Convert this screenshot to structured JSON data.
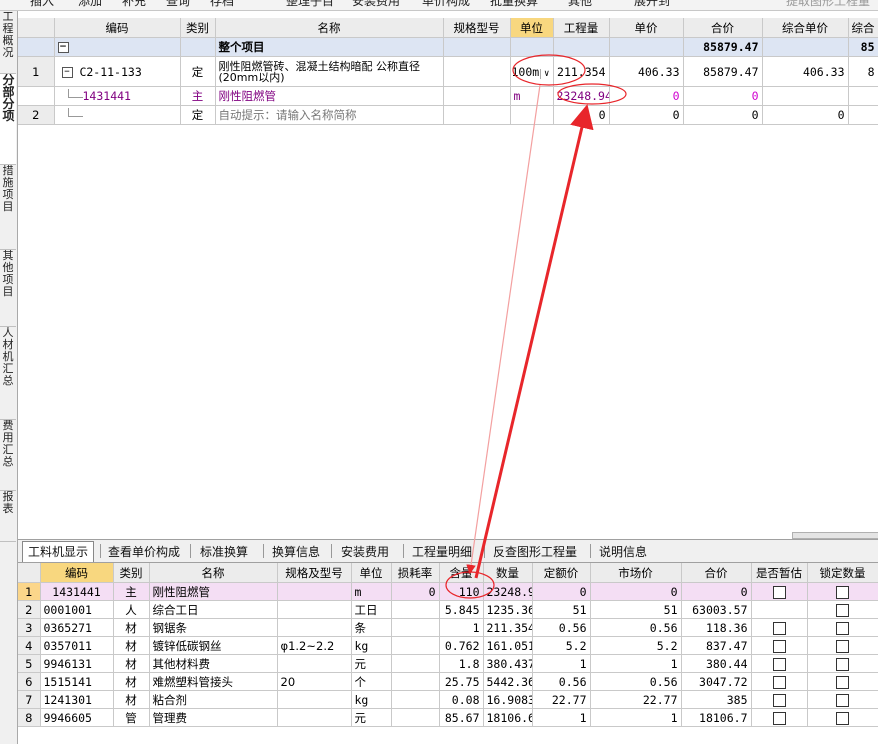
{
  "toolbar": [
    "插入",
    "添加",
    "补充",
    "查询",
    "存档",
    "整理子目",
    "安装费用",
    "单价构成",
    "批量换算",
    "其他",
    "展开到",
    "提取图形工程量"
  ],
  "side_tabs": [
    "工程概况",
    "分部分项",
    "措施项目",
    "其他项目",
    "人材机汇总",
    "费用汇总",
    "报表"
  ],
  "top_grid": {
    "headers": [
      "",
      "编码",
      "类别",
      "名称",
      "规格型号",
      "单位",
      "工程量",
      "单价",
      "合价",
      "综合单价",
      "综合"
    ],
    "total_row": {
      "toggle": "−",
      "name": "整个项目",
      "hejia": "85879.47",
      "zonghe_partial": "85"
    },
    "rows": [
      {
        "no": "1",
        "toggle": "−",
        "code": "C2-11-133",
        "type": "定",
        "name": "刚性阻燃管砖、混凝土结构暗配 公称直径(20mm以内)",
        "unit": "100m",
        "qty": "211.354",
        "price": "406.33",
        "total": "85879.47",
        "zh_price": "406.33",
        "zh_partial": "8"
      },
      {
        "no": "",
        "code": "1431441",
        "type": "主",
        "name": "刚性阻燃管",
        "unit": "m",
        "qty": "23248.94",
        "price": "0",
        "total": "0"
      },
      {
        "no": "2",
        "code": "",
        "type": "定",
        "name": "自动提示：请输入名称简称",
        "unit": "",
        "qty": "0",
        "price": "0",
        "total": "0",
        "zh_price": "0"
      }
    ]
  },
  "tabs": [
    "工料机显示",
    "查看单价构成",
    "标准换算",
    "换算信息",
    "安装费用",
    "工程量明细",
    "反查图形工程量",
    "说明信息"
  ],
  "bottom_grid": {
    "headers": [
      "",
      "编码",
      "类别",
      "名称",
      "规格及型号",
      "单位",
      "损耗率",
      "含量",
      "数量",
      "定额价",
      "市场价",
      "合价",
      "是否暂估",
      "锁定数量"
    ],
    "rows": [
      {
        "no": "1",
        "code": "1431441",
        "type": "主",
        "name": "刚性阻燃管",
        "spec": "",
        "unit": "m",
        "loss": "0",
        "content": "110",
        "qty": "23248.9",
        "quota": "0",
        "market": "0",
        "total": "0"
      },
      {
        "no": "2",
        "code": "0001001",
        "type": "人",
        "name": "综合工日",
        "spec": "",
        "unit": "工日",
        "loss": "",
        "content": "5.845",
        "qty": "1235.36",
        "quota": "51",
        "market": "51",
        "total": "63003.57"
      },
      {
        "no": "3",
        "code": "0365271",
        "type": "材",
        "name": "钢锯条",
        "spec": "",
        "unit": "条",
        "loss": "",
        "content": "1",
        "qty": "211.354",
        "quota": "0.56",
        "market": "0.56",
        "total": "118.36"
      },
      {
        "no": "4",
        "code": "0357011",
        "type": "材",
        "name": "镀锌低碳钢丝",
        "spec": "φ1.2~2.2",
        "unit": "kg",
        "loss": "",
        "content": "0.762",
        "qty": "161.051",
        "quota": "5.2",
        "market": "5.2",
        "total": "837.47"
      },
      {
        "no": "5",
        "code": "9946131",
        "type": "材",
        "name": "其他材料费",
        "spec": "",
        "unit": "元",
        "loss": "",
        "content": "1.8",
        "qty": "380.437",
        "quota": "1",
        "market": "1",
        "total": "380.44"
      },
      {
        "no": "6",
        "code": "1515141",
        "type": "材",
        "name": "难燃塑料管接头",
        "spec": "20",
        "unit": "个",
        "loss": "",
        "content": "25.75",
        "qty": "5442.36",
        "quota": "0.56",
        "market": "0.56",
        "total": "3047.72"
      },
      {
        "no": "7",
        "code": "1241301",
        "type": "材",
        "name": "粘合剂",
        "spec": "",
        "unit": "kg",
        "loss": "",
        "content": "0.08",
        "qty": "16.9083",
        "quota": "22.77",
        "market": "22.77",
        "total": "385"
      },
      {
        "no": "8",
        "code": "9946605",
        "type": "管",
        "name": "管理费",
        "spec": "",
        "unit": "元",
        "loss": "",
        "content": "85.67",
        "qty": "18106.6",
        "quota": "1",
        "market": "1",
        "total": "18106.7"
      }
    ]
  },
  "colors": {
    "header_highlight": "#f8d77f",
    "total_row": "#dde5f3",
    "selected_row": "#f4def4",
    "annotation": "#e8262b",
    "purple_text": "#800080"
  }
}
